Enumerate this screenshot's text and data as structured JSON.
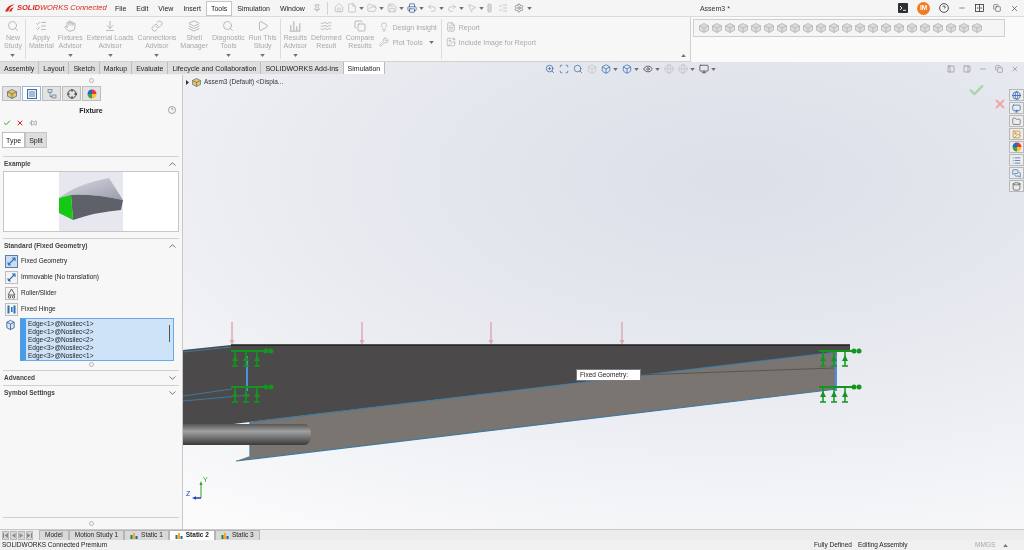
{
  "title_bar": {
    "logo": "**SOLID**WORKS Connected",
    "menus": [
      {
        "label": "File",
        "selected": false
      },
      {
        "label": "Edit",
        "selected": false
      },
      {
        "label": "View",
        "selected": false
      },
      {
        "label": "Insert",
        "selected": false
      },
      {
        "label": "Tools",
        "selected": true
      },
      {
        "label": "Simulation",
        "selected": false
      },
      {
        "label": "Window",
        "selected": false
      }
    ],
    "document_title": "Assem3 *",
    "user_initials": "IM"
  },
  "ribbon": {
    "groups": [
      {
        "large": [
          {
            "label": "New\nStudy",
            "disabled": true,
            "dropdown": true
          }
        ]
      },
      {
        "large": [
          {
            "label": "Apply\nMaterial",
            "disabled": true,
            "dropdown": false
          },
          {
            "label": "Fixtures\nAdvisor",
            "disabled": true,
            "dropdown": true
          },
          {
            "label": "External Loads\nAdvisor",
            "disabled": true,
            "dropdown": true
          },
          {
            "label": "Connections\nAdvisor",
            "disabled": true,
            "dropdown": true
          },
          {
            "label": "Shell\nManager",
            "disabled": true,
            "dropdown": false
          },
          {
            "label": "Diagnostic\nTools",
            "disabled": true,
            "dropdown": true
          },
          {
            "label": "Run This\nStudy",
            "disabled": true,
            "dropdown": true
          }
        ]
      },
      {
        "large": [
          {
            "label": "Results\nAdvisor",
            "disabled": true,
            "dropdown": true
          },
          {
            "label": "Deformed\nResult",
            "disabled": true,
            "dropdown": false
          },
          {
            "label": "Compare\nResults",
            "disabled": true,
            "dropdown": false
          }
        ],
        "small": [
          {
            "label": "Design Insight",
            "disabled": true,
            "dropdown": false
          },
          {
            "label": "Plot Tools",
            "disabled": true,
            "dropdown": true
          }
        ]
      },
      {
        "small": [
          {
            "label": "Report",
            "disabled": true,
            "dropdown": false
          },
          {
            "label": "Include Image for Report",
            "disabled": true,
            "dropdown": false
          }
        ]
      }
    ]
  },
  "command_tabs": [
    {
      "label": "Assembly",
      "selected": false
    },
    {
      "label": "Layout",
      "selected": false
    },
    {
      "label": "Sketch",
      "selected": false
    },
    {
      "label": "Markup",
      "selected": false
    },
    {
      "label": "Evaluate",
      "selected": false
    },
    {
      "label": "Lifecycle and Collaboration",
      "selected": false
    },
    {
      "label": "SOLIDWORKS Add-Ins",
      "selected": false
    },
    {
      "label": "Simulation",
      "selected": true
    }
  ],
  "property_manager": {
    "panel_tabs": [
      {
        "selected": false
      },
      {
        "selected": true
      },
      {
        "selected": false
      },
      {
        "selected": false
      },
      {
        "selected": false
      }
    ],
    "title": "Fixture",
    "sub_tabs": [
      {
        "label": "Type",
        "selected": true
      },
      {
        "label": "Split",
        "selected": false
      }
    ],
    "sections": [
      {
        "kind": "example",
        "title": "Example",
        "expanded": true
      },
      {
        "kind": "options",
        "title": "Standard (Fixed Geometry)",
        "expanded": true,
        "options": [
          {
            "label": "Fixed Geometry",
            "selected": true
          },
          {
            "label": "Immovable (No translation)",
            "selected": false
          },
          {
            "label": "Roller/Slider",
            "selected": false
          },
          {
            "label": "Fixed Hinge",
            "selected": false
          }
        ],
        "selection": [
          "Edge<1>@Nosilec<1>",
          "Edge<1>@Nosilec<2>",
          "Edge<2>@Nosilec<2>",
          "Edge<3>@Nosilec<2>",
          "Edge<3>@Nosilec<1>"
        ]
      },
      {
        "kind": "plain",
        "title": "Advanced",
        "expanded": false
      },
      {
        "kind": "plain",
        "title": "Symbol Settings",
        "expanded": false
      }
    ]
  },
  "viewport": {
    "tree_flyout": "Assem3 (Default) <Displa...",
    "callout": "Fixed Geometry:",
    "triad": {
      "y_label": "Y",
      "z_label": "Z"
    }
  },
  "study_tabs": [
    {
      "label": "Model",
      "selected": false,
      "kind": "plain"
    },
    {
      "label": "Motion Study 1",
      "selected": false,
      "kind": "plain"
    },
    {
      "label": "Static 1",
      "selected": false,
      "kind": "study"
    },
    {
      "label": "Static 2",
      "selected": true,
      "kind": "study"
    },
    {
      "label": "Static 3",
      "selected": false,
      "kind": "study"
    }
  ],
  "status_bar": {
    "product": "SOLIDWORKS Connected Premium",
    "fields": [
      {
        "label": "Fully Defined",
        "disabled": false
      },
      {
        "label": "Editing Assembly",
        "disabled": false
      },
      {
        "label": "MMGS",
        "disabled": true
      }
    ]
  }
}
